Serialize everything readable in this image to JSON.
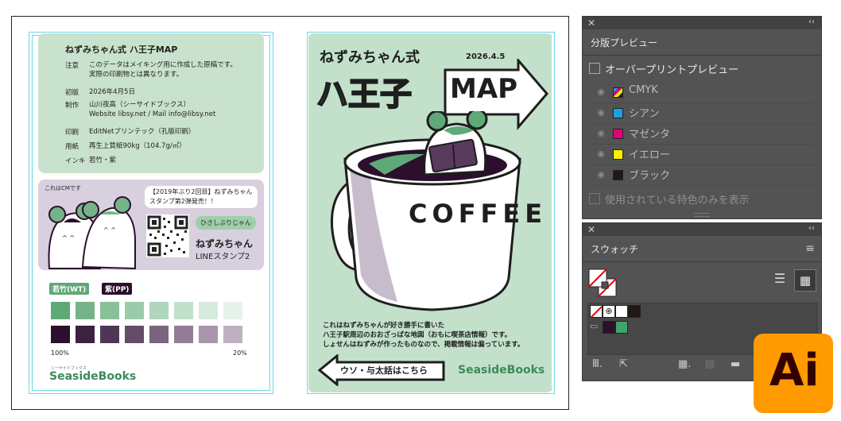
{
  "colophon": {
    "title": "ねずみちゃん式 ハ王子MAP",
    "rows": [
      {
        "key": "注意",
        "val": "このデータはメイキング用に作成した原稿です。\n実際の印刷物とは異なります。"
      },
      {
        "key": "初版",
        "val": "2026年4月5日"
      },
      {
        "key": "制作",
        "val": "山川夜高（シーサイドブックス）\nWebsite libsy.net / Mail info@libsy.net"
      },
      {
        "key": "印刷",
        "val": "EditNetプリンテック（孔版印刷）"
      },
      {
        "key": "用紙",
        "val": "再生上質紙90kg（104.7g/㎡）"
      },
      {
        "key": "インキ",
        "val": "若竹・紫"
      }
    ]
  },
  "ad": {
    "label": "これはCMです",
    "bubble_top": "【2019年ぶり2回目】ねずみちゃん\nスタンプ第2弾発売！！",
    "bubble_small": "ひさしぶりじゃん",
    "name": "ねずみちゃん",
    "sub": "LINEスタンプ2"
  },
  "swatches": {
    "label_wt": "若竹(WT)",
    "label_pp": "紫(PP)",
    "pct_left": "100%",
    "pct_right": "20%",
    "green": [
      "#5fa878",
      "#74b488",
      "#88c099",
      "#9ccbaa",
      "#b0d6bb",
      "#c3e0cc",
      "#d6ebdc",
      "#e6f2e9"
    ],
    "purple": [
      "#2b0f2c",
      "#3c2140",
      "#503655",
      "#654c6a",
      "#7b6480",
      "#927c96",
      "#a995ac",
      "#bfb0c1"
    ]
  },
  "logo_left": {
    "small": "シーサイドブックス",
    "name": "SeasideBooks"
  },
  "cover": {
    "title_small": "ねずみちゃん式",
    "date": "2026.4.5",
    "title_big": "ハ王子",
    "title_map": "MAP",
    "cup_text": "COFFEE",
    "desc": "これはねずみちゃんが好き勝手に書いた\nハ王子駅周辺のおおざっぱな地図（おもに喫茶店情報）です。\nしょせんはねずみが作ったものなので、掲載情報は偏っています。",
    "arrow_text": "ウソ・与太話はこちら",
    "logo": "SeasideBooks"
  },
  "separations_panel": {
    "tab": "分版プレビュー",
    "overprint": "オーバープリントプレビュー",
    "rows": [
      {
        "label": "CMYK",
        "color": "cmyk"
      },
      {
        "label": "シアン",
        "color": "#1ba1e2"
      },
      {
        "label": "マゼンタ",
        "color": "#e2007a"
      },
      {
        "label": "イエロー",
        "color": "#ffee00"
      },
      {
        "label": "ブラック",
        "color": "#231815"
      }
    ],
    "spot_only": "使用されている特色のみを表示"
  },
  "swatches_panel": {
    "tab": "スウォッチ"
  },
  "app_badge": {
    "label": "Ai",
    "bg": "#ff9a00",
    "fg": "#330000"
  }
}
